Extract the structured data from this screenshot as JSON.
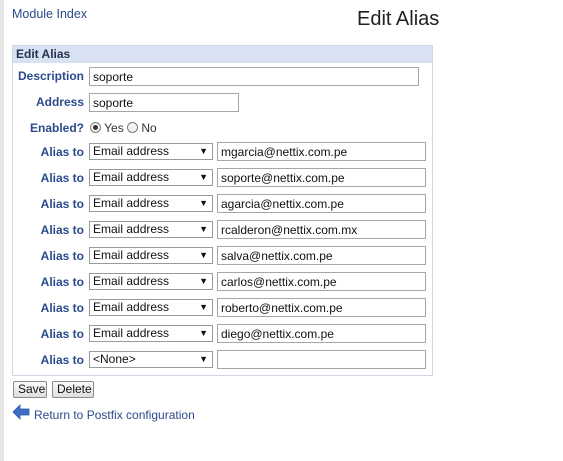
{
  "nav": {
    "module_index": "Module Index"
  },
  "page": {
    "title": "Edit Alias"
  },
  "panel": {
    "header": "Edit Alias"
  },
  "form": {
    "description_label": "Description",
    "description_value": "soporte",
    "address_label": "Address",
    "address_value": "soporte",
    "enabled_label": "Enabled?",
    "yes_label": "Yes",
    "no_label": "No",
    "enabled_selected": "Yes"
  },
  "aliases": [
    {
      "label": "Alias to",
      "type": "Email address",
      "value": "mgarcia@nettix.com.pe"
    },
    {
      "label": "Alias to",
      "type": "Email address",
      "value": "soporte@nettix.com.pe"
    },
    {
      "label": "Alias to",
      "type": "Email address",
      "value": "agarcia@nettix.com.pe"
    },
    {
      "label": "Alias to",
      "type": "Email address",
      "value": "rcalderon@nettix.com.mx"
    },
    {
      "label": "Alias to",
      "type": "Email address",
      "value": "salva@nettix.com.pe"
    },
    {
      "label": "Alias to",
      "type": "Email address",
      "value": "carlos@nettix.com.pe"
    },
    {
      "label": "Alias to",
      "type": "Email address",
      "value": "roberto@nettix.com.pe"
    },
    {
      "label": "Alias to",
      "type": "Email address",
      "value": "diego@nettix.com.pe"
    },
    {
      "label": "Alias to",
      "type": "<None>",
      "value": ""
    }
  ],
  "buttons": {
    "save": "Save",
    "delete": "Delete"
  },
  "footer": {
    "return_link": "Return to Postfix configuration",
    "arrow_icon": "back-arrow-icon"
  },
  "colors": {
    "link": "#2a4a8c",
    "header_bg": "#d8e2f3",
    "arrow": "#3b6fc4"
  }
}
